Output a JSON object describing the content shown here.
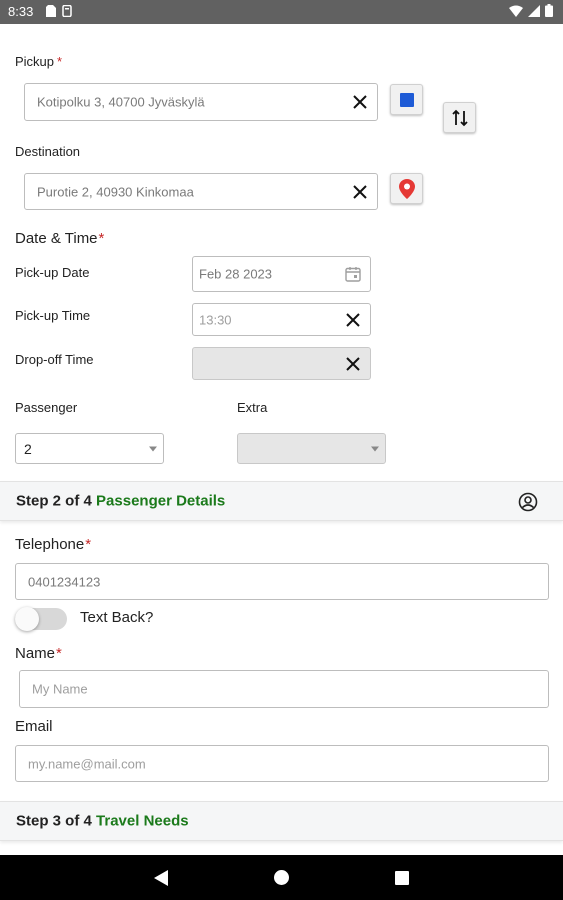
{
  "status_bar": {
    "time": "8:33",
    "left_icons": [
      "sim-card-icon",
      "storage-icon"
    ],
    "right_icons": [
      "wifi-icon",
      "signal-icon",
      "battery-icon"
    ]
  },
  "pickup": {
    "label": "Pickup",
    "required_mark": "*",
    "value": "Kotipolku 3, 40700 Jyväskylä"
  },
  "destination": {
    "label": "Destination",
    "value": "Purotie 2, 40930 Kinkomaa"
  },
  "datetime": {
    "heading": "Date & Time",
    "required_mark": "*",
    "pickup_date_label": "Pick-up Date",
    "pickup_date_value": "Feb 28 2023",
    "pickup_time_label": "Pick-up Time",
    "pickup_time_placeholder": "13:30",
    "dropoff_time_label": "Drop-off Time",
    "dropoff_time_value": ""
  },
  "passenger": {
    "label": "Passenger",
    "value": "2"
  },
  "extra": {
    "label": "Extra",
    "value": ""
  },
  "step2": {
    "prefix": "Step 2 of 4",
    "title": "Passenger Details"
  },
  "telephone": {
    "label": "Telephone",
    "required_mark": "*",
    "value": "0401234123"
  },
  "text_back": {
    "label": "Text Back?",
    "on": false
  },
  "name": {
    "label": "Name",
    "required_mark": "*",
    "placeholder": "My Name"
  },
  "email": {
    "label": "Email",
    "placeholder": "my.name@mail.com"
  },
  "step3": {
    "prefix": "Step 3 of 4",
    "title": "Travel Needs"
  },
  "colors": {
    "accent_green": "#1b7a1b",
    "required_red": "#c62828",
    "location_pin": "#e53935",
    "map_square": "#1e5bd6"
  }
}
